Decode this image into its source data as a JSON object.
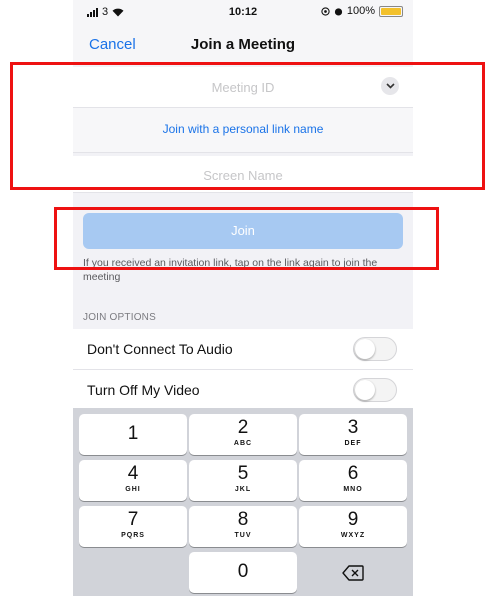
{
  "status_bar": {
    "carrier": "3",
    "time": "10:12",
    "battery_percent": "100%",
    "battery_color": "#f3c12c"
  },
  "nav": {
    "cancel_label": "Cancel",
    "title": "Join a Meeting"
  },
  "form": {
    "meeting_id_placeholder": "Meeting ID",
    "personal_link_label": "Join with a personal link name",
    "screen_name_placeholder": "Screen Name"
  },
  "join_button_label": "Join",
  "help_text": "If you received an invitation link, tap on the link again to join the meeting",
  "options": {
    "section_label": "JOIN OPTIONS",
    "items": [
      {
        "label": "Don't Connect To Audio",
        "enabled": false
      },
      {
        "label": "Turn Off My Video",
        "enabled": false
      }
    ]
  },
  "keypad": {
    "keys": [
      {
        "num": "1",
        "letters": ""
      },
      {
        "num": "2",
        "letters": "ABC"
      },
      {
        "num": "3",
        "letters": "DEF"
      },
      {
        "num": "4",
        "letters": "GHI"
      },
      {
        "num": "5",
        "letters": "JKL"
      },
      {
        "num": "6",
        "letters": "MNO"
      },
      {
        "num": "7",
        "letters": "PQRS"
      },
      {
        "num": "8",
        "letters": "TUV"
      },
      {
        "num": "9",
        "letters": "WXYZ"
      },
      {
        "num": "0",
        "letters": ""
      }
    ]
  },
  "colors": {
    "accent": "#1a73e8",
    "join_button": "#a7c9f2",
    "annotation": "#ee1111"
  }
}
